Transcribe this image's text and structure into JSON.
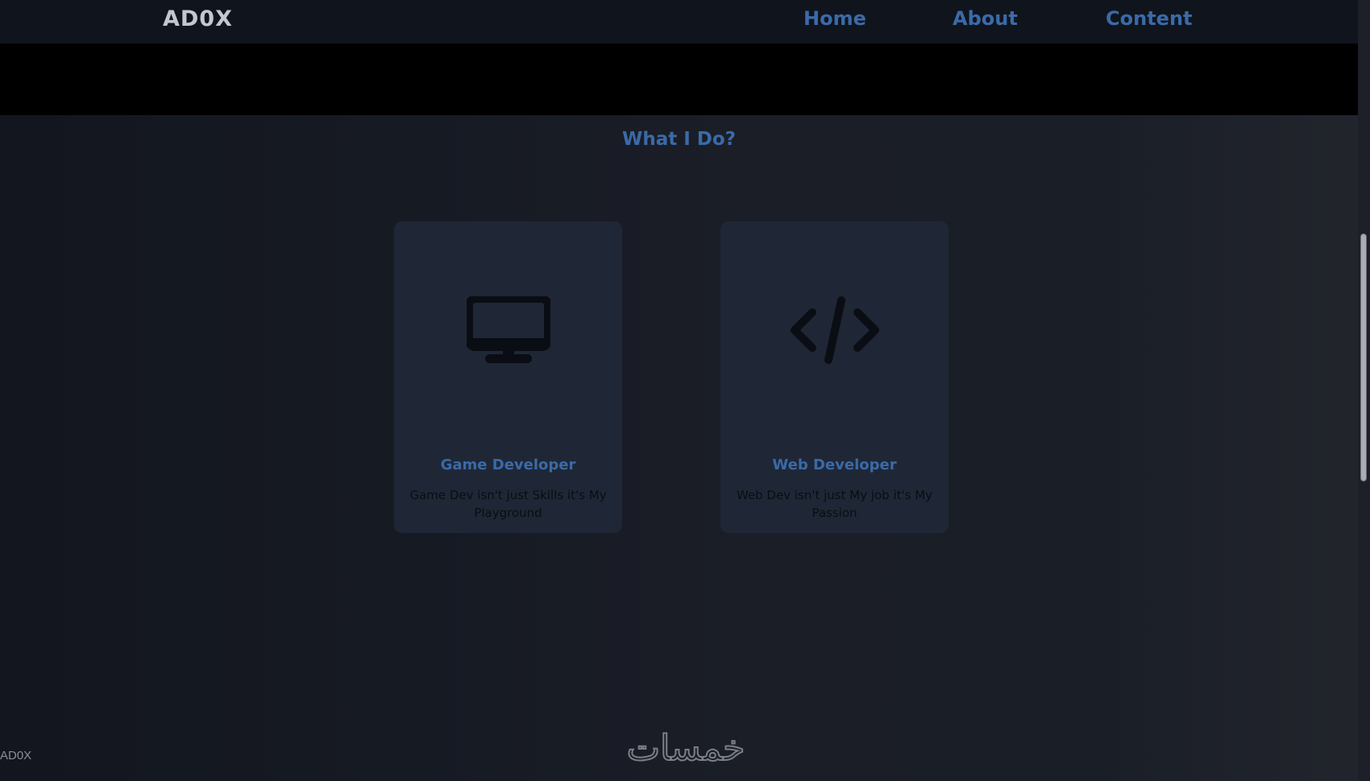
{
  "navbar": {
    "logo": "AD0X",
    "links": [
      {
        "label": "Home"
      },
      {
        "label": "About"
      },
      {
        "label": "Content"
      }
    ]
  },
  "section": {
    "title": "What I Do?"
  },
  "cards": [
    {
      "icon": "desktop-monitor-icon",
      "title": "Game Developer",
      "description": "Game Dev isn't just Skills it's My Playground"
    },
    {
      "icon": "code-brackets-icon",
      "title": "Web Developer",
      "description": "Web Dev isn't just My job it's My Passion"
    }
  ],
  "footer": {
    "text": "AD0X"
  },
  "watermark": {
    "text": "خمسات"
  },
  "colors": {
    "accent": "#3a6aa8",
    "navbar_bg": "#10141c",
    "card_bg": "#1f2736",
    "banner_bg": "#000000"
  }
}
